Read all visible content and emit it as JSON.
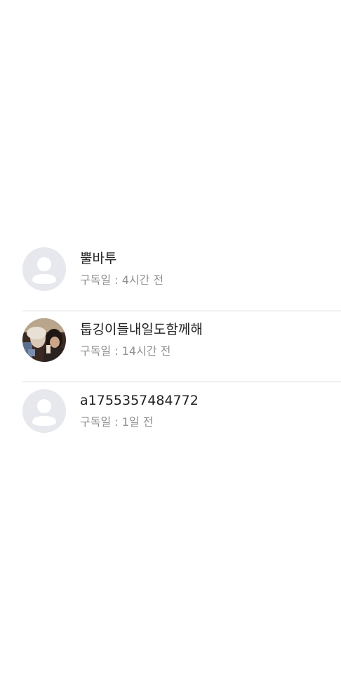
{
  "subscribers": [
    {
      "name": "뿔바투",
      "subscribed_label": "구독일 : 4시간 전",
      "avatar_icon": "default-person-icon"
    },
    {
      "name": "툽깅이들내일도함께해",
      "subscribed_label": "구독일 : 14시간 전",
      "avatar_icon": "user-photo"
    },
    {
      "name": "a1755357484772",
      "subscribed_label": "구독일 : 1일 전",
      "avatar_icon": "default-person-icon"
    }
  ],
  "colors": {
    "avatar_bg": "#e6e8ee",
    "avatar_fg": "#ffffff",
    "name_text": "#222222",
    "meta_text": "#8e8e93",
    "divider": "#dcdcdc"
  }
}
